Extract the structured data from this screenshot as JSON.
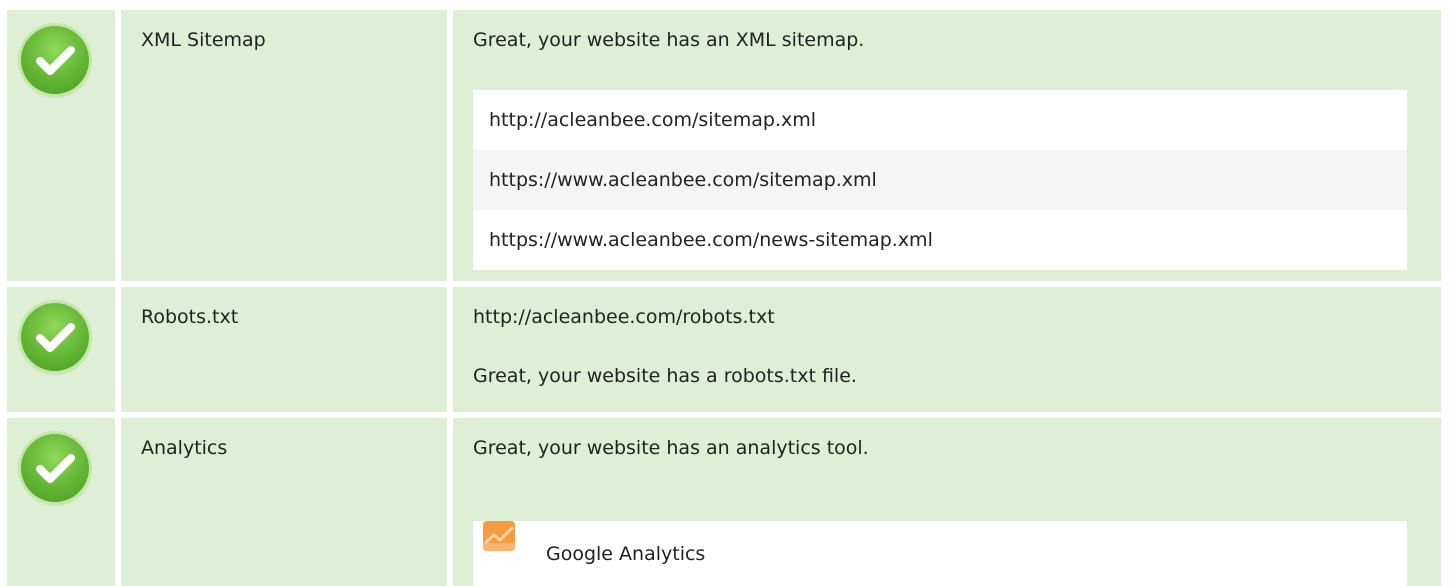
{
  "rows": [
    {
      "name": "XML Sitemap",
      "status_icon": "check-icon",
      "message": "Great, your website has an XML sitemap.",
      "sitemaps": [
        "http://acleanbee.com/sitemap.xml",
        "https://www.acleanbee.com/sitemap.xml",
        "https://www.acleanbee.com/news-sitemap.xml"
      ]
    },
    {
      "name": "Robots.txt",
      "status_icon": "check-icon",
      "url": "http://acleanbee.com/robots.txt",
      "message": "Great, your website has a robots.txt file."
    },
    {
      "name": "Analytics",
      "status_icon": "check-icon",
      "message": "Great, your website has an analytics tool.",
      "tools": [
        {
          "label": "Google Analytics",
          "icon": "google-analytics-icon"
        }
      ]
    }
  ],
  "colors": {
    "row_background": "#deefd6",
    "check_green": "#62b534",
    "list_background": "#ffffff",
    "list_alt_background": "#f5f5f5",
    "analytics_orange": "#f69b3f"
  }
}
